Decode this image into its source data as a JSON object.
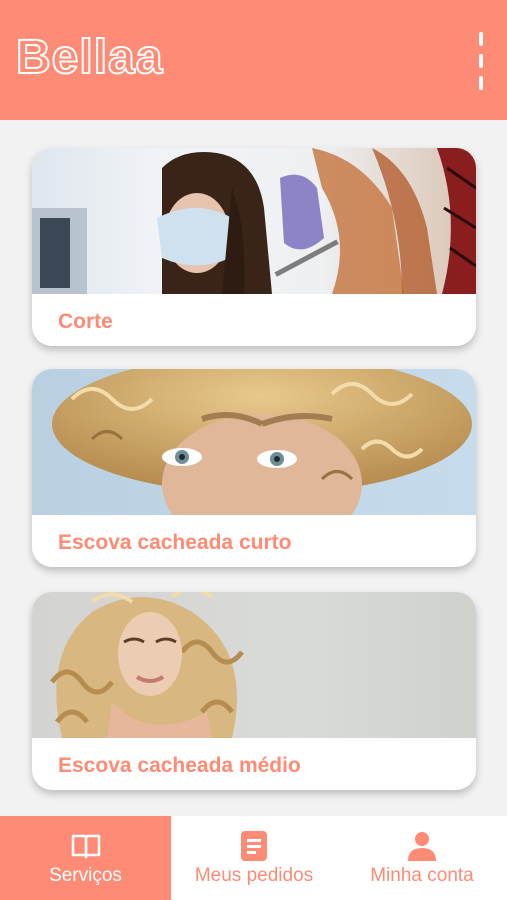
{
  "app": {
    "title": "Bellaa"
  },
  "services": [
    {
      "label": "Corte",
      "image": "haircut-photo"
    },
    {
      "label": "Escova cacheada curto",
      "image": "short-curly-hair-photo"
    },
    {
      "label": "Escova cacheada médio",
      "image": "medium-curly-hair-photo"
    }
  ],
  "tabs": [
    {
      "label": "Serviços",
      "icon": "book-icon",
      "active": true
    },
    {
      "label": "Meus pedidos",
      "icon": "document-icon",
      "active": false
    },
    {
      "label": "Minha conta",
      "icon": "person-icon",
      "active": false
    }
  ],
  "colors": {
    "accent": "#fd8b75",
    "background": "#f2f2f2",
    "card": "#ffffff"
  }
}
